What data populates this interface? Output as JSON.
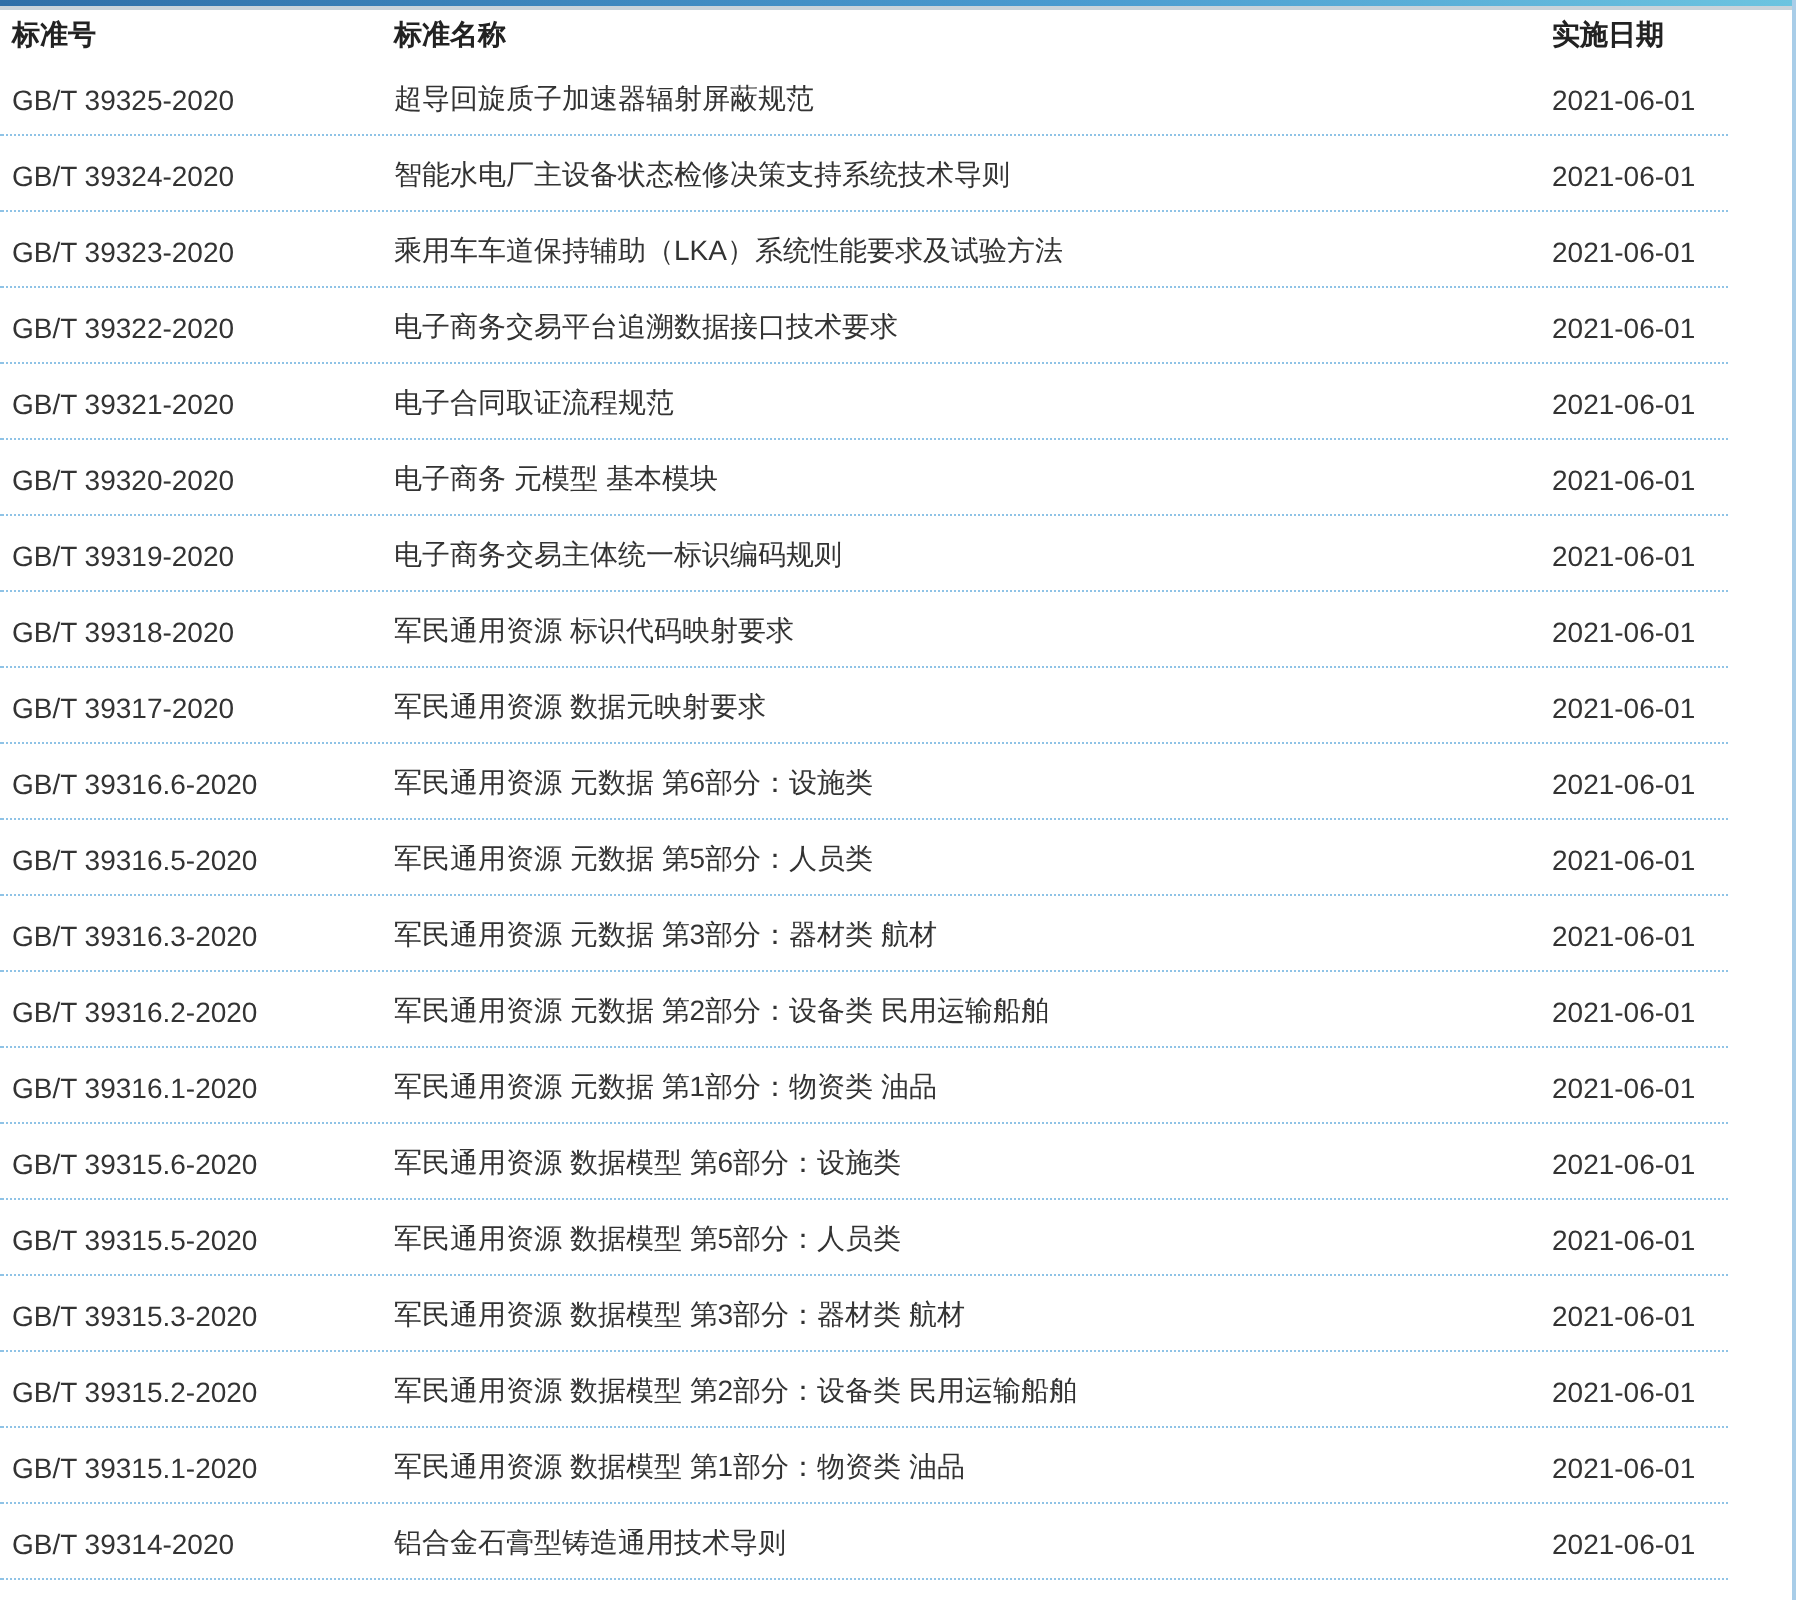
{
  "table": {
    "columns": [
      "标准号",
      "标准名称",
      "实施日期"
    ],
    "rows": [
      {
        "code": "GB/T 39325-2020",
        "title": "超导回旋质子加速器辐射屏蔽规范",
        "date": "2021-06-01"
      },
      {
        "code": "GB/T 39324-2020",
        "title": "智能水电厂主设备状态检修决策支持系统技术导则",
        "date": "2021-06-01"
      },
      {
        "code": "GB/T 39323-2020",
        "title": "乘用车车道保持辅助（LKA）系统性能要求及试验方法",
        "date": "2021-06-01"
      },
      {
        "code": "GB/T 39322-2020",
        "title": "电子商务交易平台追溯数据接口技术要求",
        "date": "2021-06-01"
      },
      {
        "code": "GB/T 39321-2020",
        "title": "电子合同取证流程规范",
        "date": "2021-06-01"
      },
      {
        "code": "GB/T 39320-2020",
        "title": "电子商务 元模型 基本模块",
        "date": "2021-06-01"
      },
      {
        "code": "GB/T 39319-2020",
        "title": "电子商务交易主体统一标识编码规则",
        "date": "2021-06-01"
      },
      {
        "code": "GB/T 39318-2020",
        "title": "军民通用资源 标识代码映射要求",
        "date": "2021-06-01"
      },
      {
        "code": "GB/T 39317-2020",
        "title": "军民通用资源 数据元映射要求",
        "date": "2021-06-01"
      },
      {
        "code": "GB/T 39316.6-2020",
        "title": "军民通用资源 元数据 第6部分：设施类",
        "date": "2021-06-01"
      },
      {
        "code": "GB/T 39316.5-2020",
        "title": "军民通用资源 元数据 第5部分：人员类",
        "date": "2021-06-01"
      },
      {
        "code": "GB/T 39316.3-2020",
        "title": "军民通用资源 元数据 第3部分：器材类 航材",
        "date": "2021-06-01"
      },
      {
        "code": "GB/T 39316.2-2020",
        "title": "军民通用资源 元数据 第2部分：设备类 民用运输船舶",
        "date": "2021-06-01"
      },
      {
        "code": "GB/T 39316.1-2020",
        "title": "军民通用资源 元数据 第1部分：物资类 油品",
        "date": "2021-06-01"
      },
      {
        "code": "GB/T 39315.6-2020",
        "title": "军民通用资源 数据模型 第6部分：设施类",
        "date": "2021-06-01"
      },
      {
        "code": "GB/T 39315.5-2020",
        "title": "军民通用资源 数据模型 第5部分：人员类",
        "date": "2021-06-01"
      },
      {
        "code": "GB/T 39315.3-2020",
        "title": "军民通用资源 数据模型 第3部分：器材类 航材",
        "date": "2021-06-01"
      },
      {
        "code": "GB/T 39315.2-2020",
        "title": "军民通用资源 数据模型 第2部分：设备类 民用运输船舶",
        "date": "2021-06-01"
      },
      {
        "code": "GB/T 39315.1-2020",
        "title": "军民通用资源 数据模型 第1部分：物资类 油品",
        "date": "2021-06-01"
      },
      {
        "code": "GB/T 39314-2020",
        "title": "铝合金石膏型铸造通用技术导则",
        "date": "2021-06-01"
      }
    ]
  }
}
